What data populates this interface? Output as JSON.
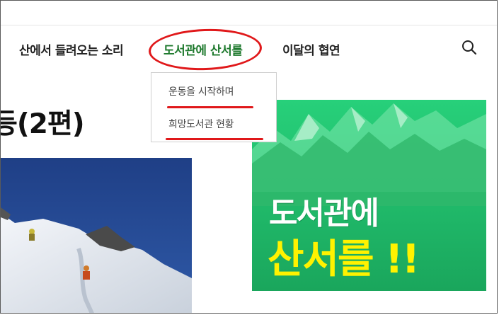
{
  "nav": {
    "items": [
      {
        "label": "산에서 들려오는 소리"
      },
      {
        "label": "도서관에 산서를"
      },
      {
        "label": "이달의 협연"
      }
    ],
    "search_icon": "search-icon"
  },
  "dropdown": {
    "items": [
      {
        "label": "운동을 시작하며"
      },
      {
        "label": "희망도서관 현황"
      }
    ]
  },
  "article": {
    "title_fragment": "등(2편)"
  },
  "banner": {
    "line1": "도서관에",
    "line2": "산서를 !!"
  },
  "colors": {
    "accent_green": "#1f7a2e",
    "annotation_red": "#e0181a",
    "banner_green": "#22c46e",
    "banner_yellow": "#fff200"
  }
}
